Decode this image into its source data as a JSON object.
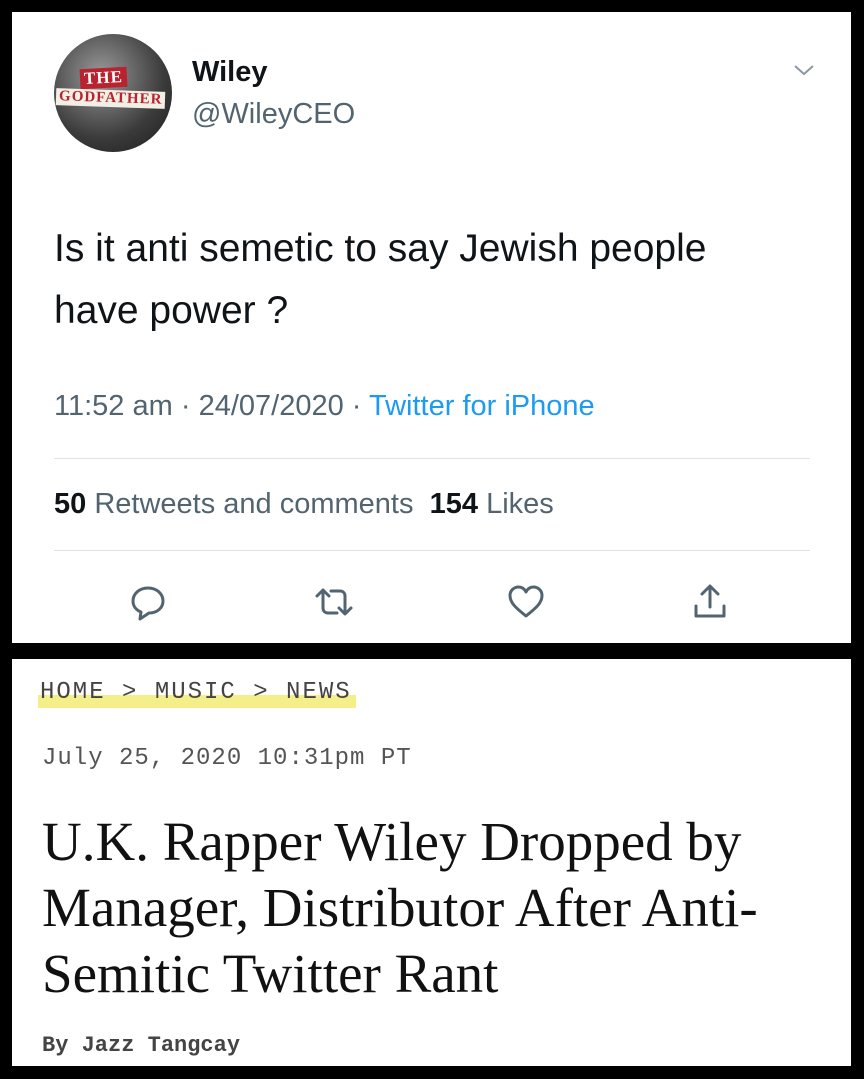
{
  "tweet": {
    "avatar_text_line1": "THE",
    "avatar_text_line2": "GODFATHER",
    "name": "Wiley",
    "handle": "@WileyCEO",
    "text": "Is it anti semetic to say Jewish people have power ?",
    "time": "11:52 am",
    "date": "24/07/2020",
    "source": "Twitter for iPhone",
    "separator": "·",
    "retweets_count": "50",
    "retweets_label": "Retweets and comments",
    "likes_count": "154",
    "likes_label": "Likes",
    "icons": [
      "chevron-down-icon",
      "reply-icon",
      "retweet-icon",
      "like-icon",
      "share-icon"
    ],
    "accent_color": "#1d9bf0"
  },
  "article": {
    "breadcrumb": "HOME > MUSIC > NEWS",
    "dateline": "July 25, 2020 10:31pm PT",
    "headline": "U.K. Rapper Wiley Dropped by Manager, Distributor After Anti-Semitic Twitter Rant",
    "byline": "By Jazz Tangcay",
    "highlight_color": "#f5ef8a"
  }
}
